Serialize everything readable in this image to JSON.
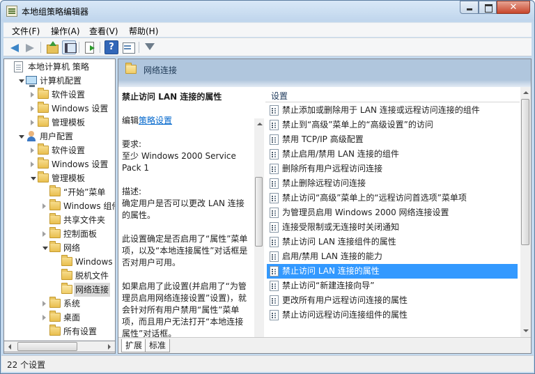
{
  "window": {
    "title": "本地组策略编辑器",
    "close_glyph": "✕"
  },
  "menu": [
    "文件(F)",
    "操作(A)",
    "查看(V)",
    "帮助(H)"
  ],
  "toolbar": {
    "icons": [
      "back-arrow",
      "forward-arrow",
      "up-folder",
      "show-hide-tree",
      "export-list",
      "help",
      "properties",
      "filter"
    ]
  },
  "tree": [
    {
      "label": "本地计算机 策略",
      "icon": "document",
      "level": 0,
      "expand": "none"
    },
    {
      "label": "计算机配置",
      "icon": "computer",
      "level": 1,
      "expand": "open"
    },
    {
      "label": "软件设置",
      "icon": "folder",
      "level": 2,
      "expand": "closed"
    },
    {
      "label": "Windows 设置",
      "icon": "folder",
      "level": 2,
      "expand": "closed"
    },
    {
      "label": "管理模板",
      "icon": "folder",
      "level": 2,
      "expand": "closed"
    },
    {
      "label": "用户配置",
      "icon": "user",
      "level": 1,
      "expand": "open"
    },
    {
      "label": "软件设置",
      "icon": "folder",
      "level": 2,
      "expand": "closed"
    },
    {
      "label": "Windows 设置",
      "icon": "folder",
      "level": 2,
      "expand": "closed"
    },
    {
      "label": "管理模板",
      "icon": "folder",
      "level": 2,
      "expand": "open"
    },
    {
      "label": "“开始”菜单",
      "icon": "folder",
      "level": 3,
      "expand": "none"
    },
    {
      "label": "Windows 组件",
      "icon": "folder",
      "level": 3,
      "expand": "closed"
    },
    {
      "label": "共享文件夹",
      "icon": "folder",
      "level": 3,
      "expand": "none"
    },
    {
      "label": "控制面板",
      "icon": "folder",
      "level": 3,
      "expand": "closed"
    },
    {
      "label": "网络",
      "icon": "folder",
      "level": 3,
      "expand": "open"
    },
    {
      "label": "Windows",
      "icon": "folder",
      "level": 4,
      "expand": "none"
    },
    {
      "label": "脱机文件",
      "icon": "folder",
      "level": 4,
      "expand": "none"
    },
    {
      "label": "网络连接",
      "icon": "folder-open",
      "level": 4,
      "expand": "none",
      "selected": true
    },
    {
      "label": "系统",
      "icon": "folder",
      "level": 3,
      "expand": "closed"
    },
    {
      "label": "桌面",
      "icon": "folder",
      "level": 3,
      "expand": "closed"
    },
    {
      "label": "所有设置",
      "icon": "folder",
      "level": 3,
      "expand": "none"
    }
  ],
  "panel": {
    "header": "网络连接",
    "desc_title": "禁止访问 LAN 连接的属性",
    "edit_prefix": "编辑",
    "edit_link": "策略设置",
    "requirement_label": "要求:",
    "requirement_value": "至少 Windows 2000 Service Pack 1",
    "description_label": "描述:",
    "description_text": "确定用户是否可以更改 LAN 连接的属性。",
    "detail_1": "此设置确定是否启用了“属性”菜单项，以及“本地连接属性”对话框是否对用户可用。",
    "detail_2": "如果启用了此设置(并启用了“为管理员启用网络连接设置”设置)，就会针对所有用户禁用“属性”菜单项，而且用户无法打开“本地连接属性”对话框。"
  },
  "list": {
    "column_header": "设置",
    "rows": [
      "禁止添加或删除用于 LAN 连接或远程访问连接的组件",
      "禁止到“高级”菜单上的“高级设置”的访问",
      "禁用 TCP/IP 高级配置",
      "禁止启用/禁用 LAN 连接的组件",
      "删除所有用户远程访问连接",
      "禁止删除远程访问连接",
      "禁止访问“高级”菜单上的“远程访问首选项”菜单项",
      "为管理员启用 Windows 2000 网络连接设置",
      "连接受限制或无连接时关闭通知",
      "禁止访问 LAN 连接组件的属性",
      "启用/禁用 LAN 连接的能力",
      "禁止访问 LAN 连接的属性",
      "禁止访问“新建连接向导”",
      "更改所有用户远程访问连接的属性",
      "禁止访问远程访问连接组件的属性"
    ],
    "selected_index": 11
  },
  "tabs": [
    "扩展",
    "标准"
  ],
  "status": "22 个设置",
  "colors": {
    "selection": "#3399ff",
    "header_band": "#b0c6dd",
    "link": "#0066cc"
  }
}
